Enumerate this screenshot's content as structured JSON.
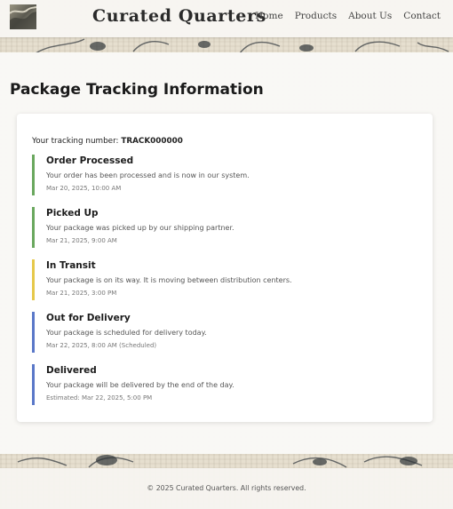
{
  "header": {
    "brand": "Curated Quarters",
    "logo_icon": "landscape-logo-icon",
    "nav": [
      "Home",
      "Products",
      "About Us",
      "Contact"
    ]
  },
  "main": {
    "title": "Package Tracking Information",
    "tracking_label": "Your tracking number:",
    "tracking_number": "TRACK000000",
    "steps": [
      {
        "title": "Order Processed",
        "desc": "Your order has been processed and is now in our system.",
        "time": "Mar 20, 2025, 10:00 AM",
        "status_color": "#6aa85e"
      },
      {
        "title": "Picked Up",
        "desc": "Your package was picked up by our shipping partner.",
        "time": "Mar 21, 2025, 9:00 AM",
        "status_color": "#6aa85e"
      },
      {
        "title": "In Transit",
        "desc": "Your package is on its way. It is moving between distribution centers.",
        "time": "Mar 21, 2025, 3:00 PM",
        "status_color": "#e6c84a"
      },
      {
        "title": "Out for Delivery",
        "desc": "Your package is scheduled for delivery today.",
        "time": "Mar 22, 2025, 8:00 AM (Scheduled)",
        "status_color": "#5a78c8"
      },
      {
        "title": "Delivered",
        "desc": "Your package will be delivered by the end of the day.",
        "time": "Estimated: Mar 22, 2025, 5:00 PM",
        "status_color": "#5a78c8"
      }
    ]
  },
  "footer": {
    "text": "© 2025 Curated Quarters. All rights reserved."
  }
}
